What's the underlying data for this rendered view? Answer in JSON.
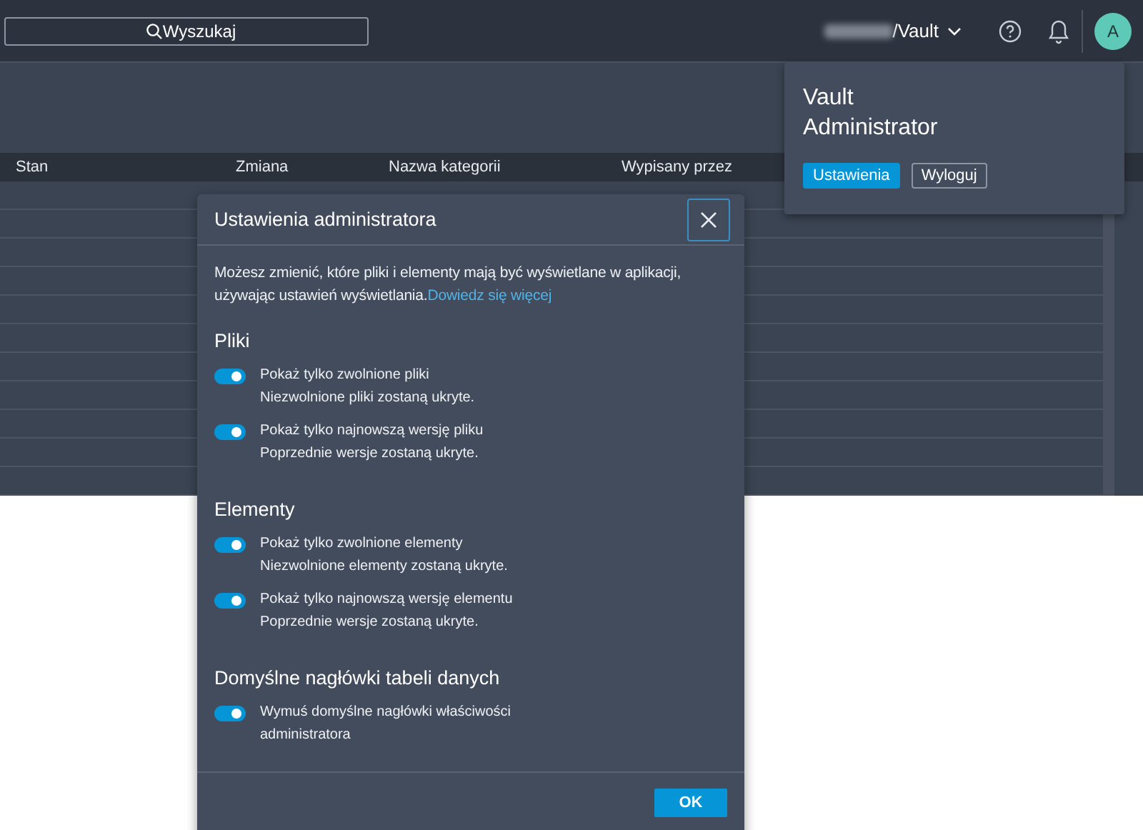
{
  "top_bar": {
    "search": {
      "placeholder": "Wyszukaj"
    },
    "vault": "/Vault",
    "avatar": "A"
  },
  "table": {
    "columns": [
      "Stan",
      "Zmiana",
      "Nazwa kategorii",
      "Wypisany przez"
    ]
  },
  "user_menu": {
    "name": "Vault\nAdministrator",
    "buttons": [
      "Ustawienia",
      "Wyloguj"
    ]
  },
  "dialog": {
    "title": "Ustawienia administratora",
    "description": "Możesz zmienić, które pliki i elementy mają być wyświetlane w aplikacji, używając ustawień wyświetlania.",
    "link": "Dowiedz się więcej",
    "sections": [
      {
        "title": "Pliki",
        "options": [
          {
            "label": "Pokaż tylko zwolnione pliki",
            "hint": "Niezwolnione pliki zostaną ukryte.",
            "on": true
          },
          {
            "label": "Pokaż tylko najnowszą wersję pliku",
            "hint": "Poprzednie wersje zostaną ukryte.",
            "on": true
          }
        ]
      },
      {
        "title": "Elementy",
        "options": [
          {
            "label": "Pokaż tylko zwolnione elementy",
            "hint": "Niezwolnione elementy zostaną ukryte.",
            "on": true
          },
          {
            "label": "Pokaż tylko najnowszą wersję elementu",
            "hint": "Poprzednie wersje zostaną ukryte.",
            "on": true
          }
        ]
      },
      {
        "title": "Domyślne nagłówki tabeli danych",
        "options": [
          {
            "label": "Wymuś domyślne nagłówki właściwości administratora",
            "on": true
          }
        ]
      }
    ],
    "ok": "OK"
  }
}
